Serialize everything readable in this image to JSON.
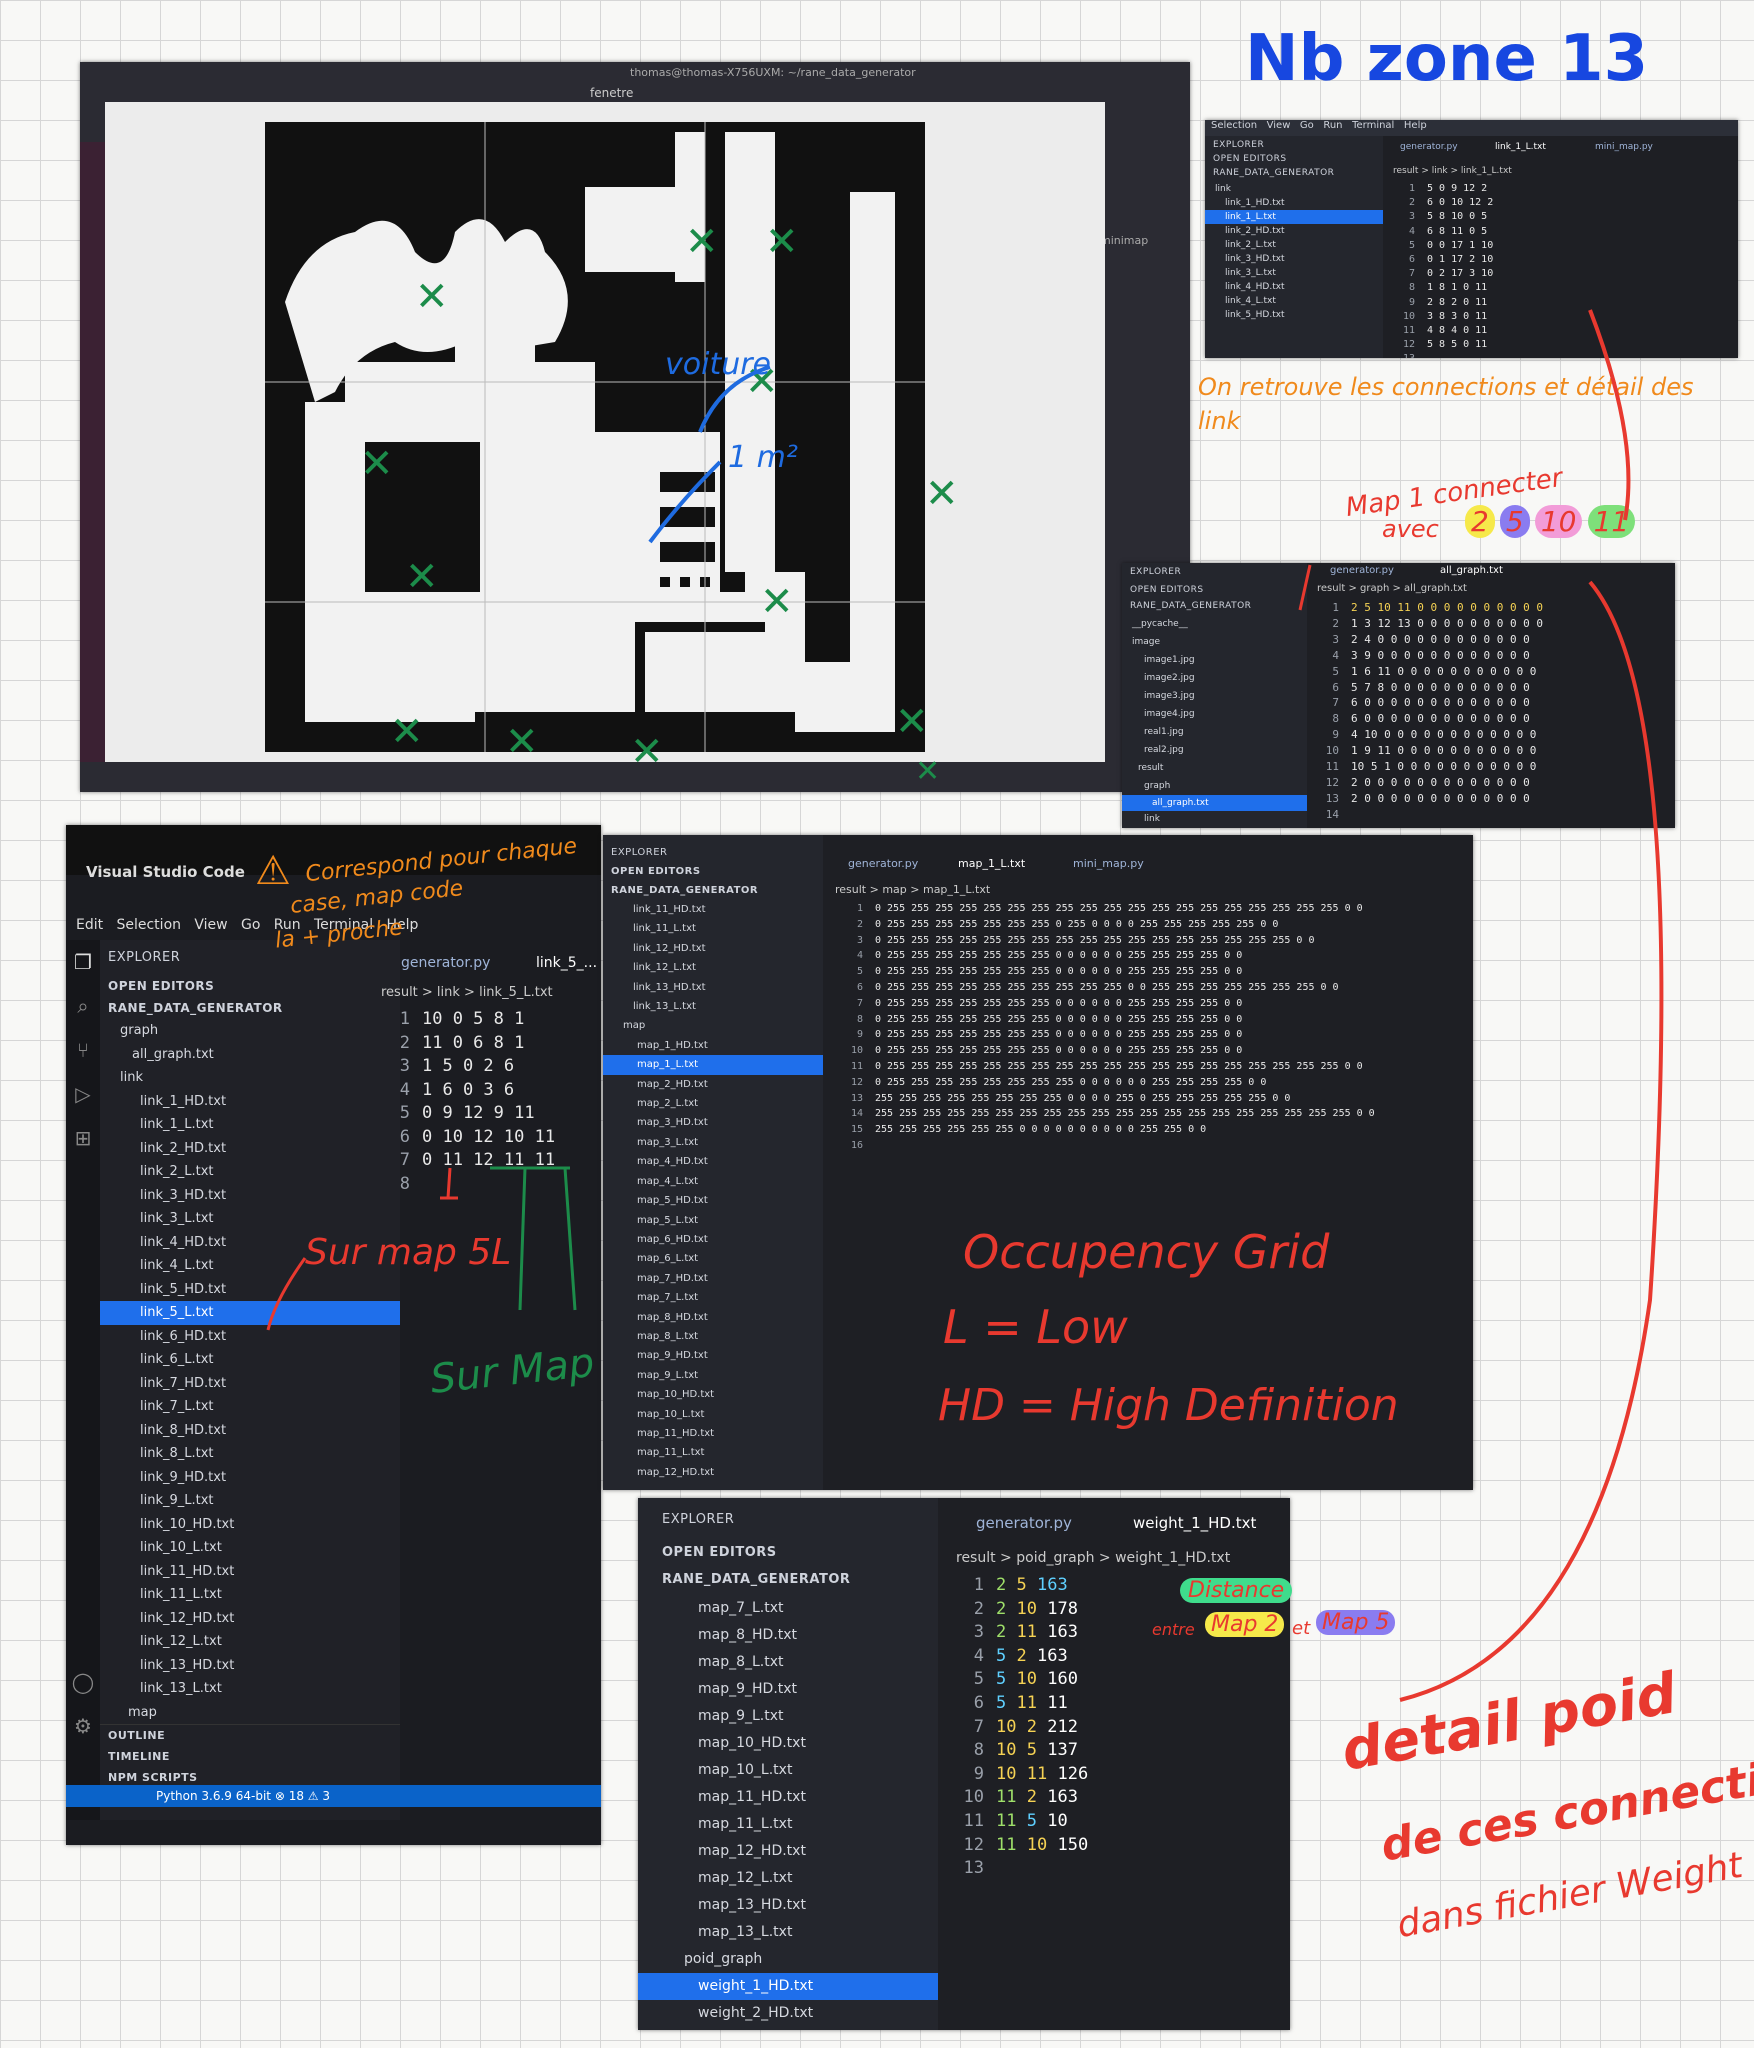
{
  "title_note": "Nb zone 13",
  "screen1": {
    "window_title": "thomas@thomas-X756UXM: ~/rane_data_generator",
    "fenetre_label": "fenetre",
    "minimap_label": "minimap",
    "annotation_voiture": "voiture",
    "annotation_1m2": "1 m²"
  },
  "screen2": {
    "menu": [
      "Selection",
      "View",
      "Go",
      "Run",
      "Terminal",
      "Help"
    ],
    "explorer": "EXPLORER",
    "open_editors": "OPEN EDITORS",
    "project": "RANE_DATA_GENERATOR",
    "tabs": [
      "generator.py",
      "link_1_L.txt",
      "mini_map.py"
    ],
    "breadcrumb": "result > link > link_1_L.txt",
    "tree": [
      "link",
      "link_1_HD.txt",
      "link_1_L.txt",
      "link_2_HD.txt",
      "link_2_L.txt",
      "link_3_HD.txt",
      "link_3_L.txt",
      "link_4_HD.txt",
      "link_4_L.txt",
      "link_5_HD.txt"
    ],
    "lines": [
      "5 0 9 12 2",
      "6 0 10 12 2",
      "5 8 10 0 5",
      "6 8 11 0 5",
      "0 0 17 1 10",
      "0 1 17 2 10",
      "0 2 17 3 10",
      "1 8 1 0 11",
      "2 8 2 0 11",
      "3 8 3 0 11",
      "4 8 4 0 11",
      "5 8 5 0 11",
      ""
    ],
    "note": "On retrouve les connections et détail des link"
  },
  "screen3": {
    "explorer": "EXPLORER",
    "open_editors": "OPEN EDITORS",
    "project": "RANE_DATA_GENERATOR",
    "tabs": [
      "generator.py",
      "all_graph.txt"
    ],
    "breadcrumb": "result > graph > all_graph.txt",
    "tree": [
      "__pycache__",
      "image",
      "image1.jpg",
      "image2.jpg",
      "image3.jpg",
      "image4.jpg",
      "real1.jpg",
      "real2.jpg",
      "result",
      "graph",
      "all_graph.txt",
      "link"
    ],
    "lines": [
      "2 5 10 11 0 0 0 0 0 0 0 0 0 0",
      "1 3 12 13 0 0 0 0 0 0 0 0 0 0",
      "2 4 0 0 0 0 0 0 0 0 0 0 0 0",
      "3 9 0 0 0 0 0 0 0 0 0 0 0 0",
      "1 6 11 0 0 0 0 0 0 0 0 0 0 0",
      "5 7 8 0 0 0 0 0 0 0 0 0 0 0",
      "6 0 0 0 0 0 0 0 0 0 0 0 0 0",
      "6 0 0 0 0 0 0 0 0 0 0 0 0 0",
      "4 10 0 0 0 0 0 0 0 0 0 0 0 0",
      "1 9 11 0 0 0 0 0 0 0 0 0 0 0",
      "10 5 1 0 0 0 0 0 0 0 0 0 0 0",
      "2 0 0 0 0 0 0 0 0 0 0 0 0 0",
      "2 0 0 0 0 0 0 0 0 0 0 0 0 0",
      ""
    ],
    "note1": "Map 1 connecter",
    "note2": "avec",
    "note_values": [
      "2",
      "5",
      "10",
      "11"
    ]
  },
  "screen4": {
    "app": "Visual Studio Code",
    "menu": [
      "Edit",
      "Selection",
      "View",
      "Go",
      "Run",
      "Terminal",
      "Help"
    ],
    "explorer": "EXPLORER",
    "open_editors": "OPEN EDITORS",
    "project": "RANE_DATA_GENERATOR",
    "tabs": [
      "generator.py",
      "link_5_..."
    ],
    "breadcrumb": "result > link > link_5_L.txt",
    "tree": [
      "graph",
      "all_graph.txt",
      "link",
      "link_1_HD.txt",
      "link_1_L.txt",
      "link_2_HD.txt",
      "link_2_L.txt",
      "link_3_HD.txt",
      "link_3_L.txt",
      "link_4_HD.txt",
      "link_4_L.txt",
      "link_5_HD.txt",
      "link_5_L.txt",
      "link_6_HD.txt",
      "link_6_L.txt",
      "link_7_HD.txt",
      "link_7_L.txt",
      "link_8_HD.txt",
      "link_8_L.txt",
      "link_9_HD.txt",
      "link_9_L.txt",
      "link_10_HD.txt",
      "link_10_L.txt",
      "link_11_HD.txt",
      "link_11_L.txt",
      "link_12_HD.txt",
      "link_12_L.txt",
      "link_13_HD.txt",
      "link_13_L.txt",
      "map"
    ],
    "sections": [
      "OUTLINE",
      "TIMELINE",
      "NPM SCRIPTS"
    ],
    "status": "Python 3.6.9 64-bit   ⊗ 18 ⚠ 3",
    "lines": [
      "10 0 5 8 1",
      "11 0 6 8 1",
      "1 5 0 2 6",
      "1 6 0 3 6",
      "0 9 12 9 11",
      "0 10 12 10 11",
      "0 11 12 11 11",
      ""
    ],
    "note_top1": "Correspond pour chaque",
    "note_top2": "case, map code",
    "note_top3": "la + proche",
    "note_map5": "Sur map 5L",
    "note_map11": "Sur Map 11"
  },
  "screen5": {
    "explorer": "EXPLORER",
    "open_editors": "OPEN EDITORS",
    "project": "RANE_DATA_GENERATOR",
    "tabs": [
      "generator.py",
      "map_1_L.txt",
      "mini_map.py"
    ],
    "breadcrumb": "result > map > map_1_L.txt",
    "tree": [
      "link_11_HD.txt",
      "link_11_L.txt",
      "link_12_HD.txt",
      "link_12_L.txt",
      "link_13_HD.txt",
      "link_13_L.txt",
      "map",
      "map_1_HD.txt",
      "map_1_L.txt",
      "map_2_HD.txt",
      "map_2_L.txt",
      "map_3_HD.txt",
      "map_3_L.txt",
      "map_4_HD.txt",
      "map_4_L.txt",
      "map_5_HD.txt",
      "map_5_L.txt",
      "map_6_HD.txt",
      "map_6_L.txt",
      "map_7_HD.txt",
      "map_7_L.txt",
      "map_8_HD.txt",
      "map_8_L.txt",
      "map_9_HD.txt",
      "map_9_L.txt",
      "map_10_HD.txt",
      "map_10_L.txt",
      "map_11_HD.txt",
      "map_11_L.txt",
      "map_12_HD.txt"
    ],
    "lines": [
      "0 255 255 255 255 255 255 255 255 255 255 255 255 255 255 255 255 255 255 255 0 0",
      "0 255 255 255 255 255 255 255 0 255 0 0 0 0 255 255 255 255 255 0 0",
      "0 255 255 255 255 255 255 255 255 255 255 255 255 255 255 255 255 255 0 0",
      "0 255 255 255 255 255 255 255 0 0 0 0 0 0 255 255 255 255 0 0",
      "0 255 255 255 255 255 255 255 0 0 0 0 0 0 255 255 255 255 0 0",
      "0 255 255 255 255 255 255 255 255 255 255 0 0 255 255 255 255 255 255 255 0 0",
      "0 255 255 255 255 255 255 255 0 0 0 0 0 0 255 255 255 255 0 0",
      "0 255 255 255 255 255 255 255 0 0 0 0 0 0 255 255 255 255 0 0",
      "0 255 255 255 255 255 255 255 0 0 0 0 0 0 255 255 255 255 0 0",
      "0 255 255 255 255 255 255 255 0 0 0 0 0 0 255 255 255 255 0 0",
      "0 255 255 255 255 255 255 255 255 255 255 255 255 255 255 255 255 255 255 255 0 0",
      "0 255 255 255 255 255 255 255 255 0 0 0 0 0 0 255 255 255 255 0 0",
      "255 255 255 255 255 255 255 255 0 0 0 0 255 0 255 255 255 255 255 0 0",
      "255 255 255 255 255 255 255 255 255 255 255 255 255 255 255 255 255 255 255 255 0 0",
      "255 255 255 255 255 255 0 0 0 0 0 0 0 0 0 0 255 255 0 0",
      ""
    ],
    "note1": "Occupency Grid",
    "note2": "L = Low",
    "note3": "HD = High Definition"
  },
  "screen6": {
    "explorer": "EXPLORER",
    "open_editors": "OPEN EDITORS",
    "project": "RANE_DATA_GENERATOR",
    "tabs": [
      "generator.py",
      "weight_1_HD.txt"
    ],
    "breadcrumb": "result > poid_graph > weight_1_HD.txt",
    "tree": [
      "map_7_L.txt",
      "map_8_HD.txt",
      "map_8_L.txt",
      "map_9_HD.txt",
      "map_9_L.txt",
      "map_10_HD.txt",
      "map_10_L.txt",
      "map_11_HD.txt",
      "map_11_L.txt",
      "map_12_HD.txt",
      "map_12_L.txt",
      "map_13_HD.txt",
      "map_13_L.txt",
      "poid_graph",
      "weight_1_HD.txt",
      "weight_2_HD.txt"
    ],
    "rows": [
      [
        "2",
        "5",
        "163"
      ],
      [
        "2",
        "10",
        "178"
      ],
      [
        "2",
        "11",
        "163"
      ],
      [
        "5",
        "2",
        "163"
      ],
      [
        "5",
        "10",
        "160"
      ],
      [
        "5",
        "11",
        "11"
      ],
      [
        "10",
        "2",
        "212"
      ],
      [
        "10",
        "5",
        "137"
      ],
      [
        "10",
        "11",
        "126"
      ],
      [
        "11",
        "2",
        "163"
      ],
      [
        "11",
        "5",
        "10"
      ],
      [
        "11",
        "10",
        "150"
      ],
      [
        "",
        "",
        ""
      ]
    ],
    "note_distance": "Distance",
    "note_entre": "entre",
    "note_map2": "Map 2",
    "note_et": "et",
    "note_map5": "Map 5",
    "note_bottom1": "detail poid",
    "note_bottom2": "de ces connections",
    "note_bottom3": "dans fichier Weight"
  },
  "colors": {
    "annot_red": "#e8392f",
    "annot_blue": "#1747e0",
    "annot_orange": "#f08a1c",
    "annot_green": "#1c8c4a"
  }
}
